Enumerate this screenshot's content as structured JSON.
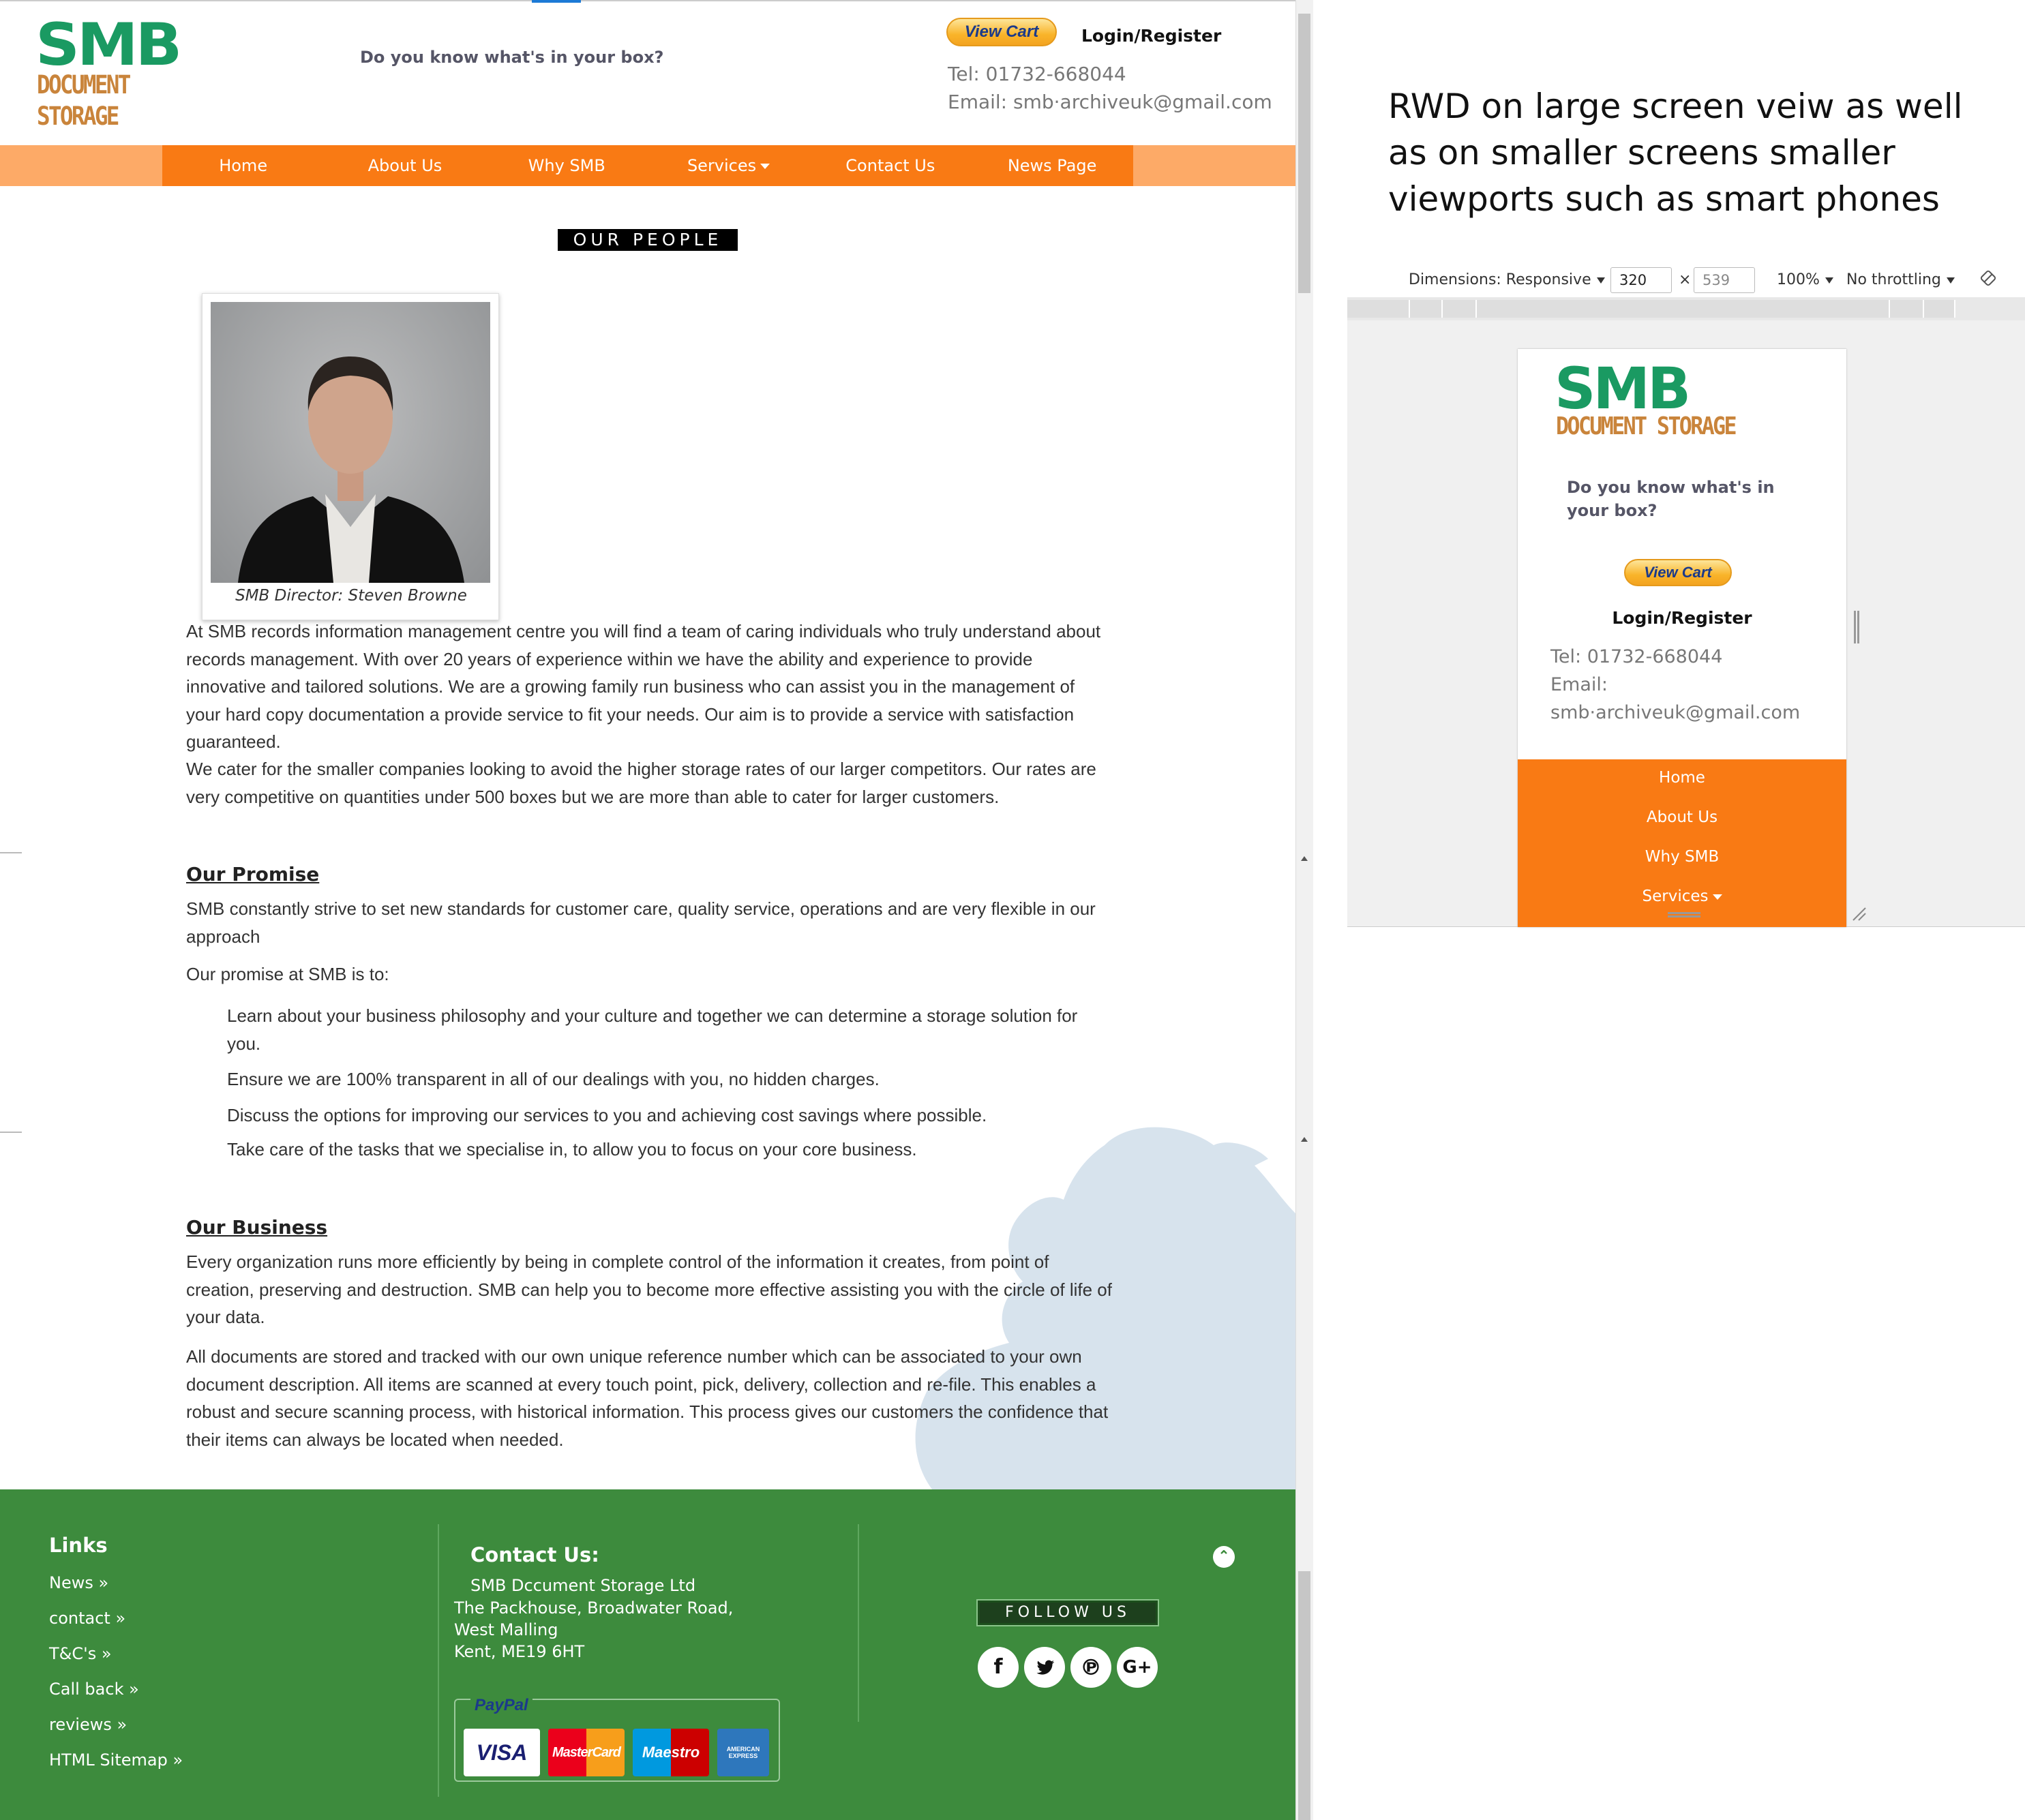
{
  "header": {
    "logo_top": "SMB",
    "logo_bottom": "DOCUMENT STORAGE",
    "tagline": "Do you know what's in your box?",
    "view_cart": "View Cart",
    "login": "Login/Register",
    "tel": "Tel: 01732-668044",
    "email": "Email: smb·archiveuk@gmail.com"
  },
  "nav": {
    "items": [
      "Home",
      "About Us",
      "Why SMB",
      "Services",
      "Contact Us",
      "News Page"
    ]
  },
  "people": {
    "heading": "OUR PEOPLE",
    "caption": "SMB Director: Steven Browne",
    "intro": [
      "At SMB records information management centre you will find a team of caring individuals who truly understand about records management. With over 20 years of experience within we have the ability and experience to provide innovative and tailored solutions. We are a growing family run business who can assist you in the management of your hard copy documentation a provide service to fit your needs. Our aim is to provide a service with satisfaction guaranteed.",
      "We cater for the smaller companies looking to avoid the higher storage rates of our larger competitors. Our rates are very competitive on quantities under 500 boxes but we are more than able to cater for larger customers."
    ]
  },
  "promise": {
    "title": "Our Promise",
    "text": "SMB constantly strive to set new standards for customer care, quality service, operations and are very flexible in our approach",
    "lead": "Our promise at SMB is to:",
    "items": [
      "Learn about your business philosophy and your culture and together we can determine a storage solution for you.",
      "Ensure we are 100% transparent in all of our dealings with you, no hidden charges.",
      "Discuss the options for improving our services to you and achieving cost savings where possible.",
      "Take care of the tasks that we specialise in, to allow you to focus on your core business."
    ]
  },
  "business": {
    "title": "Our Business",
    "p1": "Every organization runs more efficiently by being in complete control of the information it creates, from point of creation, preserving and destruction. SMB can help you to become more effective assisting you with the circle of life of your data.",
    "p2": "All documents are stored and tracked with our own unique reference number which can be associated to your own document description. All items are scanned at every touch point, pick, delivery, collection and re-file. This enables a robust and secure scanning process, with historical information. This process gives our customers the confidence that their items can always be located when needed."
  },
  "footer": {
    "links_title": "Links",
    "links": [
      "News »",
      "contact »",
      "T&C's »",
      "Call back »",
      "reviews »",
      "HTML Sitemap »"
    ],
    "contact_title": "Contact Us:",
    "company": "SMB Dccument Storage Ltd",
    "address": [
      "The Packhouse, Broadwater Road,",
      "West Malling",
      "Kent, ME19 6HT"
    ],
    "follow": "FOLLOW US",
    "social_icons": [
      "facebook-icon",
      "twitter-icon",
      "pinterest-icon",
      "google-plus-icon"
    ],
    "payment": {
      "paypal": "PayPal",
      "cards": [
        "VISA",
        "MasterCard",
        "Maestro",
        "AMERICAN EXPRESS"
      ]
    }
  },
  "annotation": {
    "note": "RWD on large screen veiw as well as on smaller screens smaller viewports such as smart phones"
  },
  "devtools": {
    "dimensions": "Dimensions: Responsive",
    "width": "320",
    "times": "×",
    "height": "539",
    "zoom": "100%",
    "throttle": "No throttling"
  },
  "mobile": {
    "logo_top": "SMB",
    "logo_bottom": "DOCUMENT STORAGE",
    "tagline": "Do you know what's in your box?",
    "view_cart": "View Cart",
    "login": "Login/Register",
    "tel": "Tel: 01732-668044",
    "email_label": "Email:",
    "email": "smb·archiveuk@gmail.com",
    "nav": [
      "Home",
      "About Us",
      "Why SMB",
      "Services"
    ]
  },
  "colors": {
    "nav_orange": "#f97a14",
    "nav_light": "#fdaa67",
    "footer_green": "#3d8b3d",
    "logo_green": "#1a9a62",
    "logo_gold": "#c9843b"
  }
}
